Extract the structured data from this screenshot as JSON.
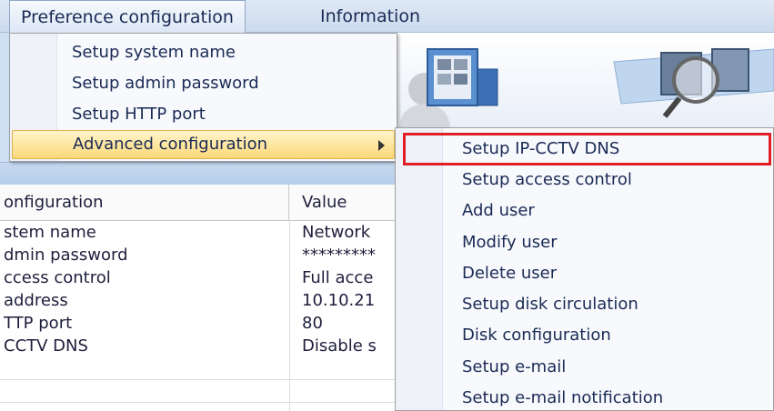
{
  "menubar": {
    "tabs": [
      {
        "label": "Preference configuration"
      },
      {
        "label": "Information"
      }
    ]
  },
  "preference_menu": {
    "items": [
      {
        "label": "Setup system name"
      },
      {
        "label": "Setup admin password"
      },
      {
        "label": "Setup HTTP port"
      },
      {
        "label": "Advanced configuration"
      }
    ]
  },
  "advanced_submenu": {
    "items": [
      {
        "label": "Setup IP-CCTV DNS"
      },
      {
        "label": "Setup access control"
      },
      {
        "label": "Add user"
      },
      {
        "label": "Modify user"
      },
      {
        "label": "Delete user"
      },
      {
        "label": "Setup disk circulation"
      },
      {
        "label": "Disk configuration"
      },
      {
        "label": "Setup e-mail"
      },
      {
        "label": "Setup e-mail notification"
      }
    ],
    "highlight_color": "#e01f26"
  },
  "config_table": {
    "headers": [
      "onfiguration",
      "Value"
    ],
    "rows": [
      [
        "stem name",
        "Network"
      ],
      [
        "dmin password",
        "*********"
      ],
      [
        "ccess control",
        "Full acce"
      ],
      [
        " address",
        "10.10.21"
      ],
      [
        "TTP port",
        "80"
      ],
      [
        " CCTV DNS",
        "Disable s"
      ]
    ]
  }
}
